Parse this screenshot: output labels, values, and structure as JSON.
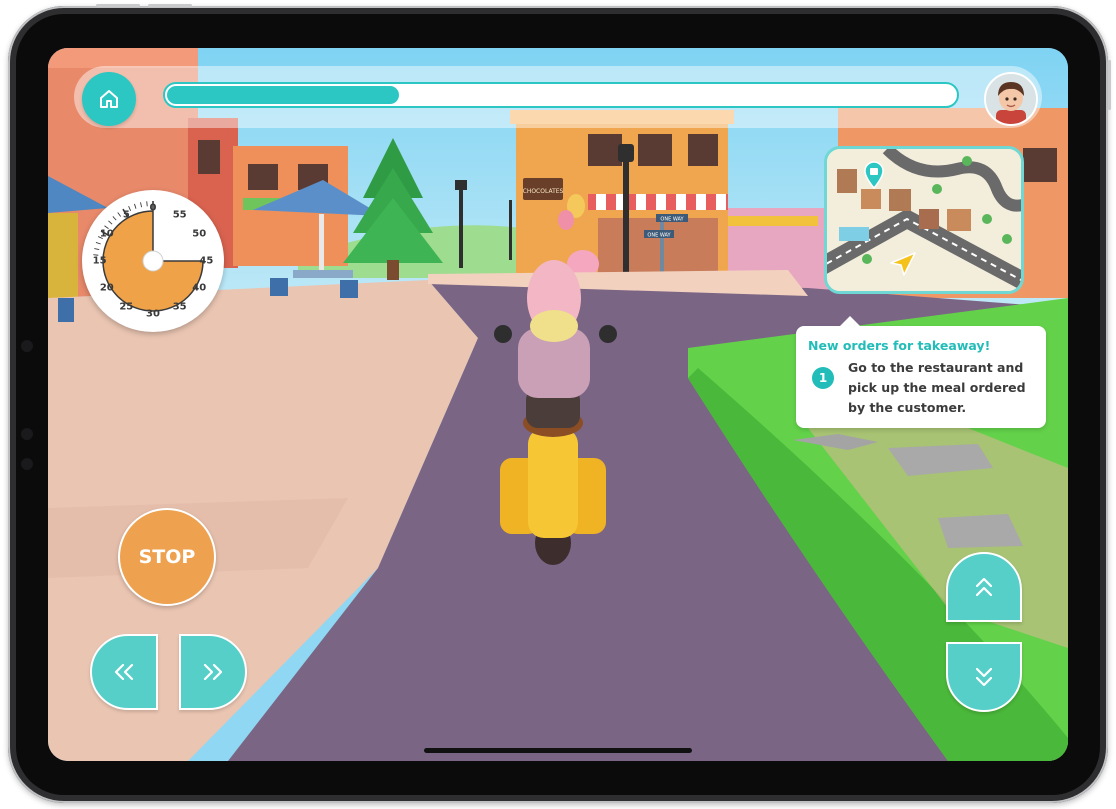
{
  "hud": {
    "progress_fraction": 0.295,
    "home_icon": "home-icon",
    "avatar_icon": "boy-avatar-icon"
  },
  "timer": {
    "minute_labels": [
      "0",
      "5",
      "10",
      "15",
      "20",
      "25",
      "30",
      "35",
      "40",
      "45",
      "50",
      "55"
    ],
    "remaining_minutes": 45
  },
  "minimap": {
    "pin_icon": "shopping-bag-pin-icon",
    "player_icon": "navigation-arrow-icon"
  },
  "notification": {
    "title": "New orders for takeaway!",
    "step_number": "1",
    "step_text": "Go to the restaurant and pick up the meal ordered by the customer."
  },
  "scene": {
    "shop_sign": "CHOCOLATES",
    "street_sign_1": "ONE WAY",
    "street_sign_2": "ONE WAY"
  },
  "controls": {
    "stop_label": "STOP",
    "left_icon": "double-chevron-left-icon",
    "right_icon": "double-chevron-right-icon",
    "up_icon": "double-chevron-up-icon",
    "down_icon": "double-chevron-down-icon"
  },
  "colors": {
    "accent": "#2cc7c3",
    "stop": "#eea14f",
    "road": "#7b6585",
    "grass": "#63d24a",
    "sidewalk": "#e9c4b2"
  }
}
